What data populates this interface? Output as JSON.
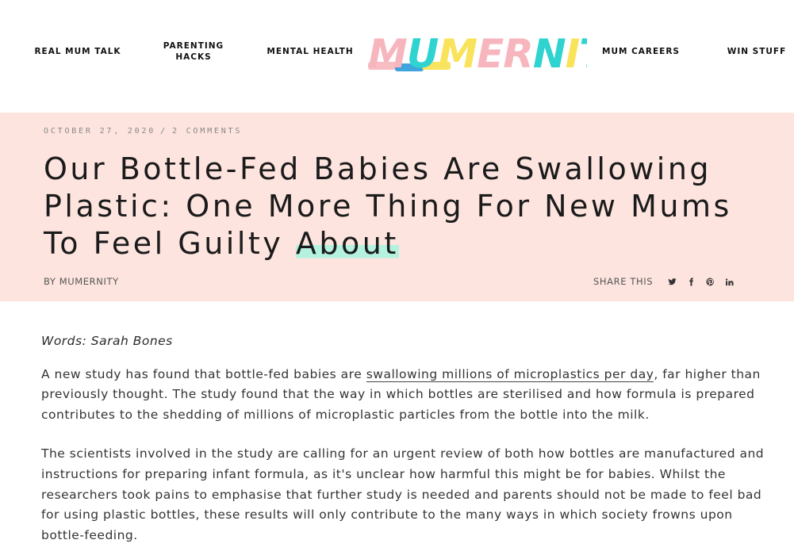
{
  "nav": {
    "items": [
      {
        "label": "REAL MUM TALK"
      },
      {
        "label": "PARENTING\nHACKS"
      },
      {
        "label": "MENTAL HEALTH"
      },
      {
        "label": "MUM CAREERS"
      },
      {
        "label": "WIN STUFF"
      }
    ]
  },
  "logo": {
    "text": "MUMERNITY",
    "colors": {
      "pink": "#f7b6bd",
      "yellow": "#f9e35a",
      "teal": "#2fd3cf",
      "blue": "#2a9bd8"
    }
  },
  "post": {
    "date": "October 27, 2020",
    "separator": "/",
    "comments": "2 Comments",
    "title_main": "Our Bottle-Fed Babies Are Swallowing Plastic: One More Thing For New Mums To Feel Guilty ",
    "title_highlight": "About",
    "byline_prefix": "BY ",
    "author": "MUMERNITY",
    "share_label": "SHARE THIS",
    "share_icons": [
      "twitter-icon",
      "facebook-icon",
      "pinterest-icon",
      "linkedin-icon"
    ],
    "hero_bg": "#fde4df",
    "highlight_color": "#b4f2df"
  },
  "article": {
    "credit": "Words: Sarah Bones",
    "p1_before": "A new study has found that bottle-fed babies are ",
    "p1_link": "swallowing millions of microplastics per day",
    "p1_after": ", far higher than previously thought. The study found that the way in which bottles are sterilised and how formula is prepared contributes to the shedding of millions of microplastic particles from the bottle into the milk.",
    "p2": "The scientists involved in the study are calling for an urgent review of both how bottles are manufactured and instructions for preparing infant formula, as it's unclear how harmful this might be for babies. Whilst the researchers took pains to emphasise that further study is needed and parents should not be made to feel bad for using plastic bottles, these results will only contribute to the many ways in which society frowns upon bottle-feeding."
  }
}
